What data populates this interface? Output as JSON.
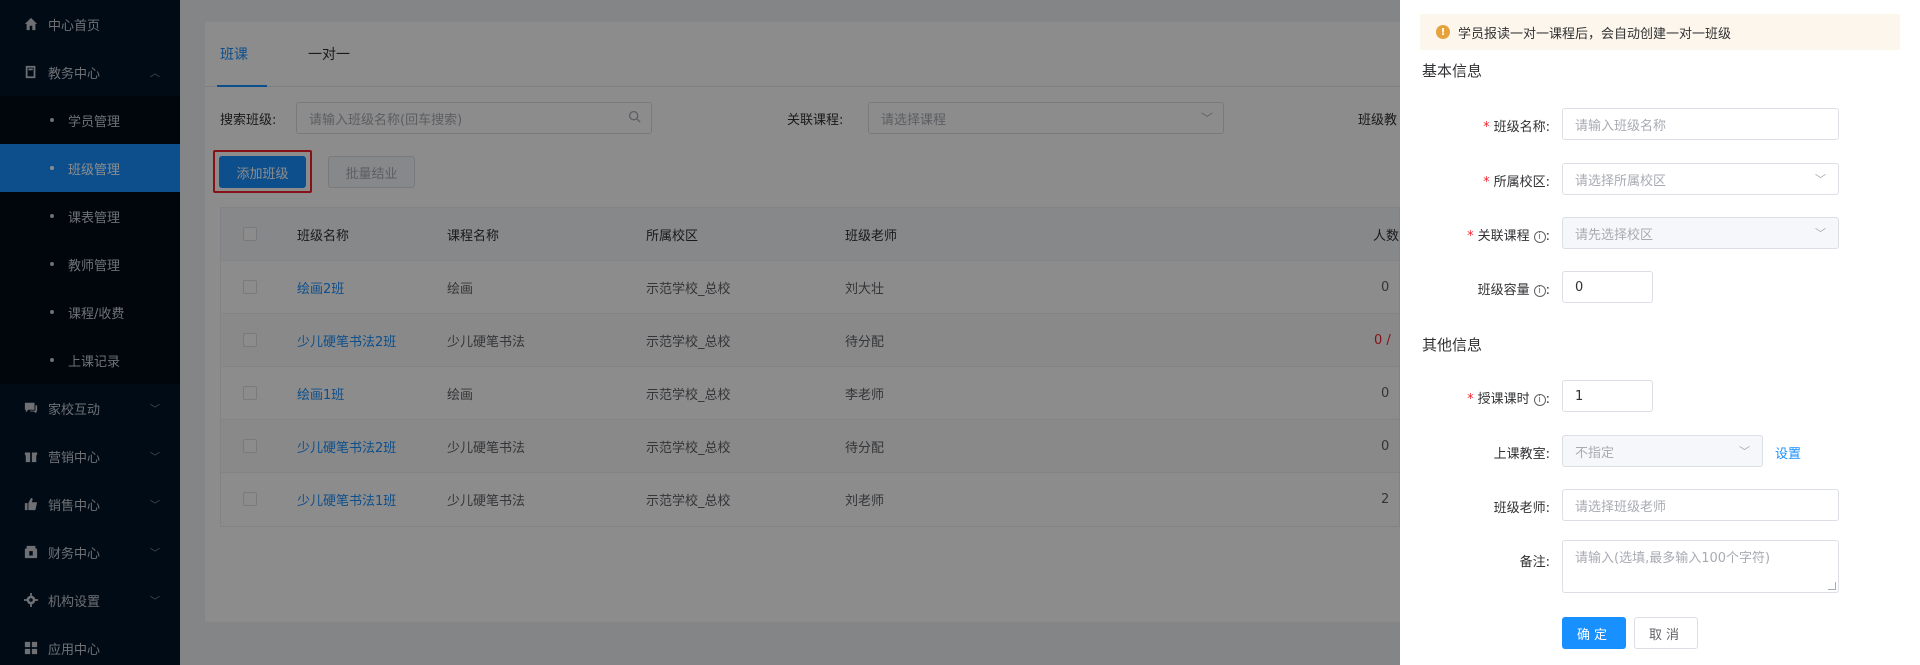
{
  "sidebar": {
    "items": [
      {
        "label": "中心首页",
        "icon": "home-icon"
      },
      {
        "label": "教务中心",
        "icon": "book-icon",
        "expanded": true,
        "children": [
          "学员管理",
          "班级管理",
          "课表管理",
          "教师管理",
          "课程/收费",
          "上课记录"
        ],
        "active_child": "班级管理"
      },
      {
        "label": "家校互动",
        "icon": "chat-icon"
      },
      {
        "label": "营销中心",
        "icon": "gift-icon"
      },
      {
        "label": "销售中心",
        "icon": "thumb-icon"
      },
      {
        "label": "财务中心",
        "icon": "wallet-icon"
      },
      {
        "label": "机构设置",
        "icon": "gear-icon"
      },
      {
        "label": "应用中心",
        "icon": "grid-icon"
      }
    ]
  },
  "main": {
    "tabs": [
      {
        "label": "班课",
        "active": true
      },
      {
        "label": "一对一",
        "active": false
      }
    ],
    "filters": {
      "class_label": "搜索班级:",
      "class_placeholder": "请输入班级名称(回车搜索)",
      "course_label": "关联课程:",
      "course_placeholder": "请选择课程",
      "teacher_label": "班级教"
    },
    "buttons": {
      "add": "添加班级",
      "batch": "批量结业"
    },
    "table": {
      "headers": [
        "班级名称",
        "课程名称",
        "所属校区",
        "班级老师",
        "人数"
      ],
      "rows": [
        {
          "name": "绘画2班",
          "course": "绘画",
          "campus": "示范学校_总校",
          "teacher": "刘大壮",
          "count": "0"
        },
        {
          "name": "少儿硬笔书法2班",
          "course": "少儿硬笔书法",
          "campus": "示范学校_总校",
          "teacher": "待分配",
          "count": "0 /",
          "count_red": true
        },
        {
          "name": "绘画1班",
          "course": "绘画",
          "campus": "示范学校_总校",
          "teacher": "李老师",
          "count": "0"
        },
        {
          "name": "少儿硬笔书法2班",
          "course": "少儿硬笔书法",
          "campus": "示范学校_总校",
          "teacher": "待分配",
          "count": "0"
        },
        {
          "name": "少儿硬笔书法1班",
          "course": "少儿硬笔书法",
          "campus": "示范学校_总校",
          "teacher": "刘老师",
          "count": "2"
        }
      ]
    }
  },
  "drawer": {
    "notice": "学员报读一对一课程后，会自动创建一对一班级",
    "basic_title": "基本信息",
    "other_title": "其他信息",
    "fields": {
      "class_name": {
        "label": "班级名称:",
        "placeholder": "请输入班级名称"
      },
      "campus": {
        "label": "所属校区:",
        "placeholder": "请选择所属校区"
      },
      "course": {
        "label": "关联课程",
        "placeholder": "请先选择校区"
      },
      "capacity": {
        "label": "班级容量",
        "value": "0"
      },
      "hours": {
        "label": "授课课时",
        "value": "1"
      },
      "classroom": {
        "label": "上课教室:",
        "placeholder": "不指定",
        "link": "设置"
      },
      "teacher": {
        "label": "班级老师:",
        "placeholder": "请选择班级老师"
      },
      "remark": {
        "label": "备注:",
        "placeholder": "请输入(选填,最多输入100个字符)"
      }
    },
    "confirm": "确定",
    "cancel": "取消"
  },
  "colors": {
    "primary": "#1890ff",
    "sidebar": "#001529",
    "danger": "#f5222d",
    "warning": "#e6a23c"
  }
}
